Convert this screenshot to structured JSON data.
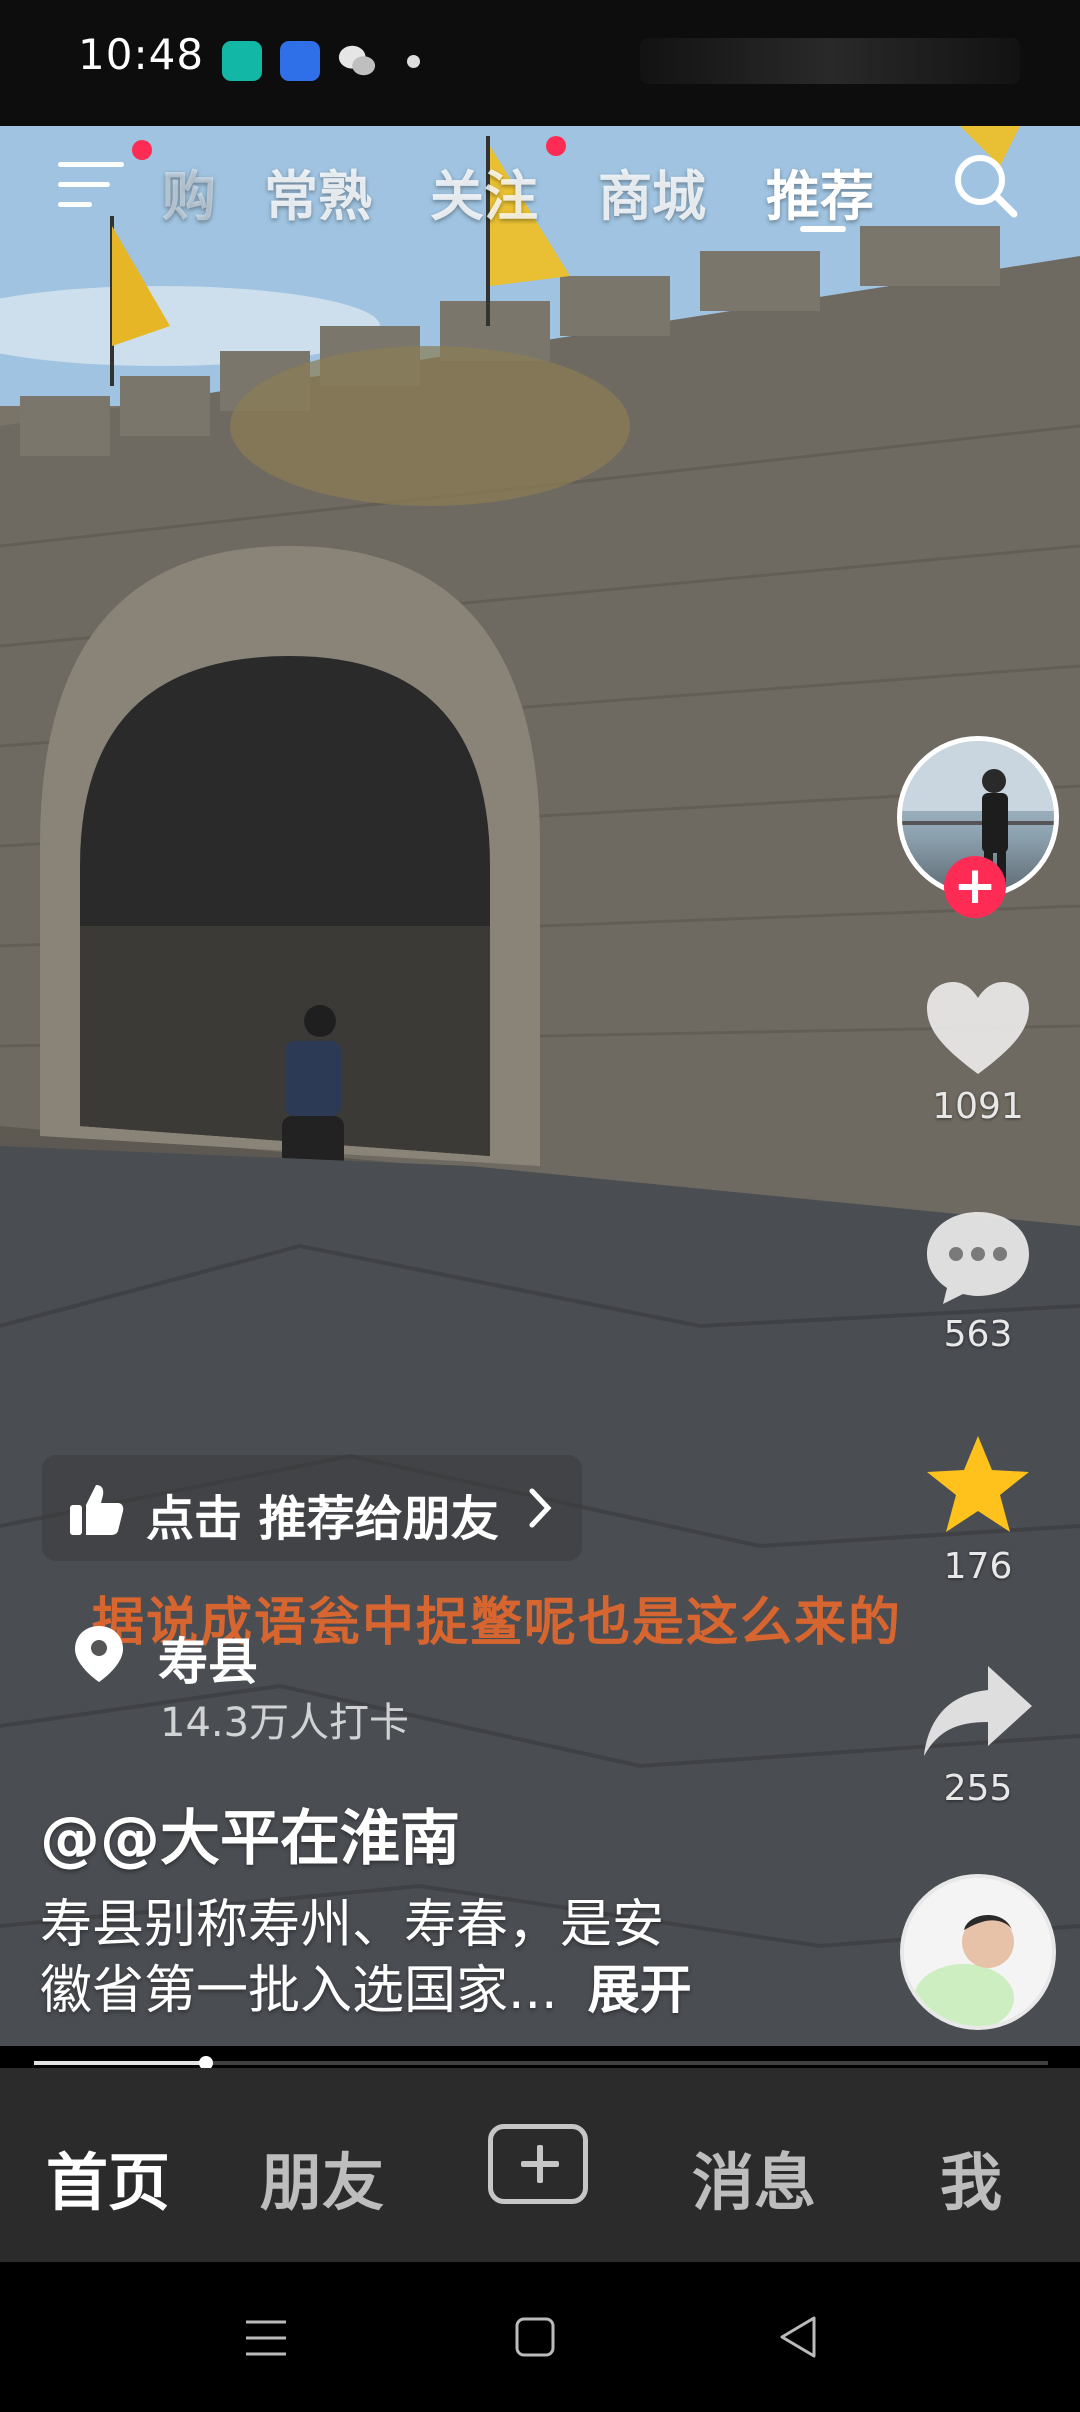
{
  "status_bar": {
    "time": "10:48"
  },
  "top_nav": {
    "tabs": [
      {
        "label": "购"
      },
      {
        "label": "常熟"
      },
      {
        "label": "关注"
      },
      {
        "label": "商城"
      },
      {
        "label": "推荐"
      }
    ],
    "active_tab": "推荐"
  },
  "actions": {
    "like_count": "1091",
    "comment_count": "563",
    "favorite_count": "176",
    "share_count": "255"
  },
  "video": {
    "recommend_label": "点击 推荐给朋友",
    "subtitle": "据说成语瓮中捉鳖呢也是这么来的",
    "location_name": "寿县",
    "location_checkins": "14.3万人打卡",
    "author": "@@大平在淮南",
    "description_line1": "寿县别称寿州、寿春，是安",
    "description_line2": "徽省第一批入选国家...",
    "expand_label": "展开",
    "progress_fraction": 0.17
  },
  "bottom_tabs": {
    "home": "首页",
    "friends": "朋友",
    "messages": "消息",
    "me": "我"
  },
  "colors": {
    "accent": "#fe2c55",
    "star": "#ffc21c",
    "subtitle": "#f06a2a"
  }
}
